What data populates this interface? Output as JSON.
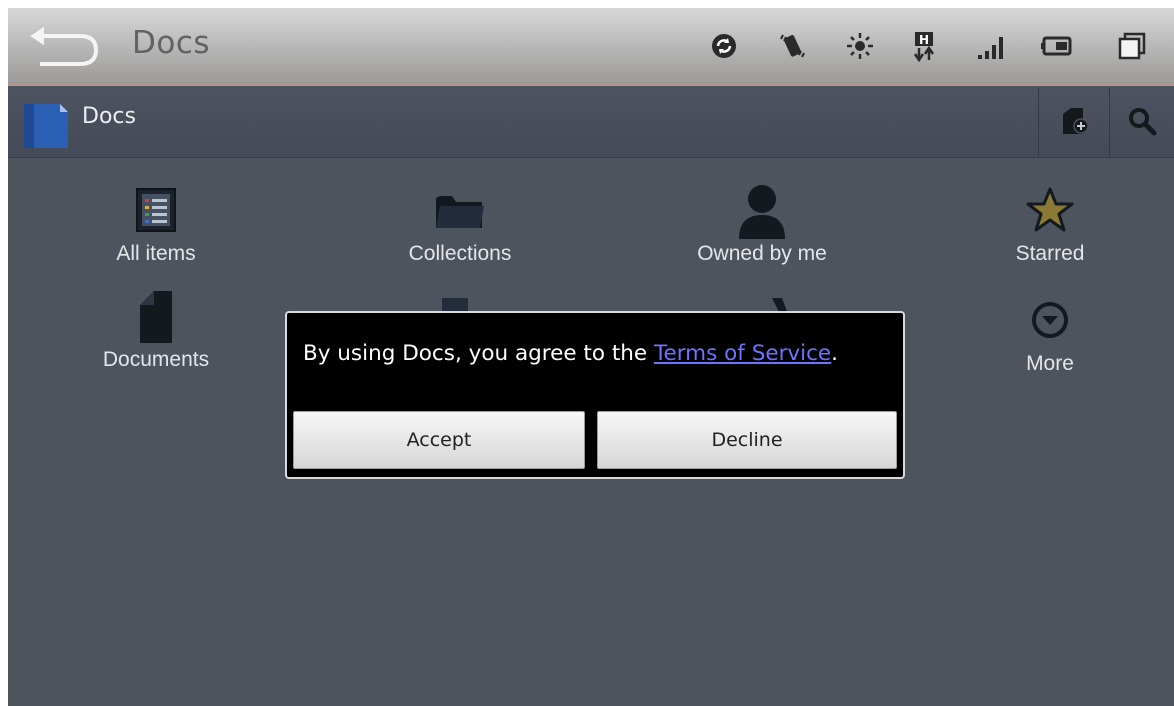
{
  "status_bar": {
    "title": "Docs",
    "icons": [
      "back-arrow-icon",
      "sync-icon",
      "vibrate-icon",
      "brightness-icon",
      "hsdpa-data-icon",
      "signal-icon",
      "battery-icon",
      "recent-apps-icon"
    ]
  },
  "action_bar": {
    "title": "Docs",
    "actions": [
      "new-document-icon",
      "search-icon"
    ]
  },
  "grid": [
    {
      "label": "All items",
      "icon": "list-icon"
    },
    {
      "label": "Collections",
      "icon": "folder-icon"
    },
    {
      "label": "Owned by me",
      "icon": "person-icon"
    },
    {
      "label": "Starred",
      "icon": "star-icon"
    },
    {
      "label": "Documents",
      "icon": "document-icon"
    },
    {
      "label": "More",
      "icon": "more-chevron-icon"
    }
  ],
  "dialog": {
    "message_prefix": "By using Docs, you agree to the ",
    "link_text": "Terms of Service",
    "message_suffix": ".",
    "accept_label": "Accept",
    "decline_label": "Decline"
  },
  "colors": {
    "background": "#4e545e",
    "link": "#6d72ff",
    "dialog_bg": "#000000"
  }
}
